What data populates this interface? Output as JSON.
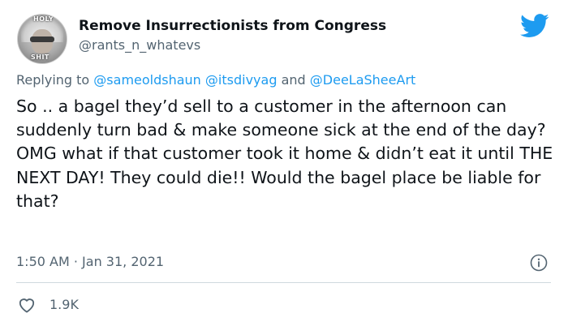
{
  "colors": {
    "accent": "#1d9bf0",
    "text": "#0f1419",
    "secondary": "#536471",
    "divider": "#cfd9de"
  },
  "author": {
    "display_name": "Remove Insurrectionists from Congress",
    "handle": "@rants_n_whatevs",
    "avatar_text_top": "HOLY",
    "avatar_text_bottom": "SHIT"
  },
  "brand": {
    "icon": "twitter-bird-icon"
  },
  "reply": {
    "prefix": "Replying to",
    "mentions": [
      "@sameoldshaun",
      "@itsdivyag",
      "@DeeLaSheeArt"
    ],
    "conjunction": "and"
  },
  "tweet": {
    "text": "So .. a bagel they’d sell to a customer in the afternoon can suddenly turn bad & make someone sick at the end of the day? OMG what if that customer took it home & didn’t eat it until THE NEXT DAY! They could die!! Would the bagel place be liable for that?",
    "time": "1:50 AM",
    "separator": "·",
    "date": "Jan 31, 2021"
  },
  "stats": {
    "like_icon": "heart-icon",
    "likes": "1.9K"
  },
  "info_icon": "info-icon"
}
